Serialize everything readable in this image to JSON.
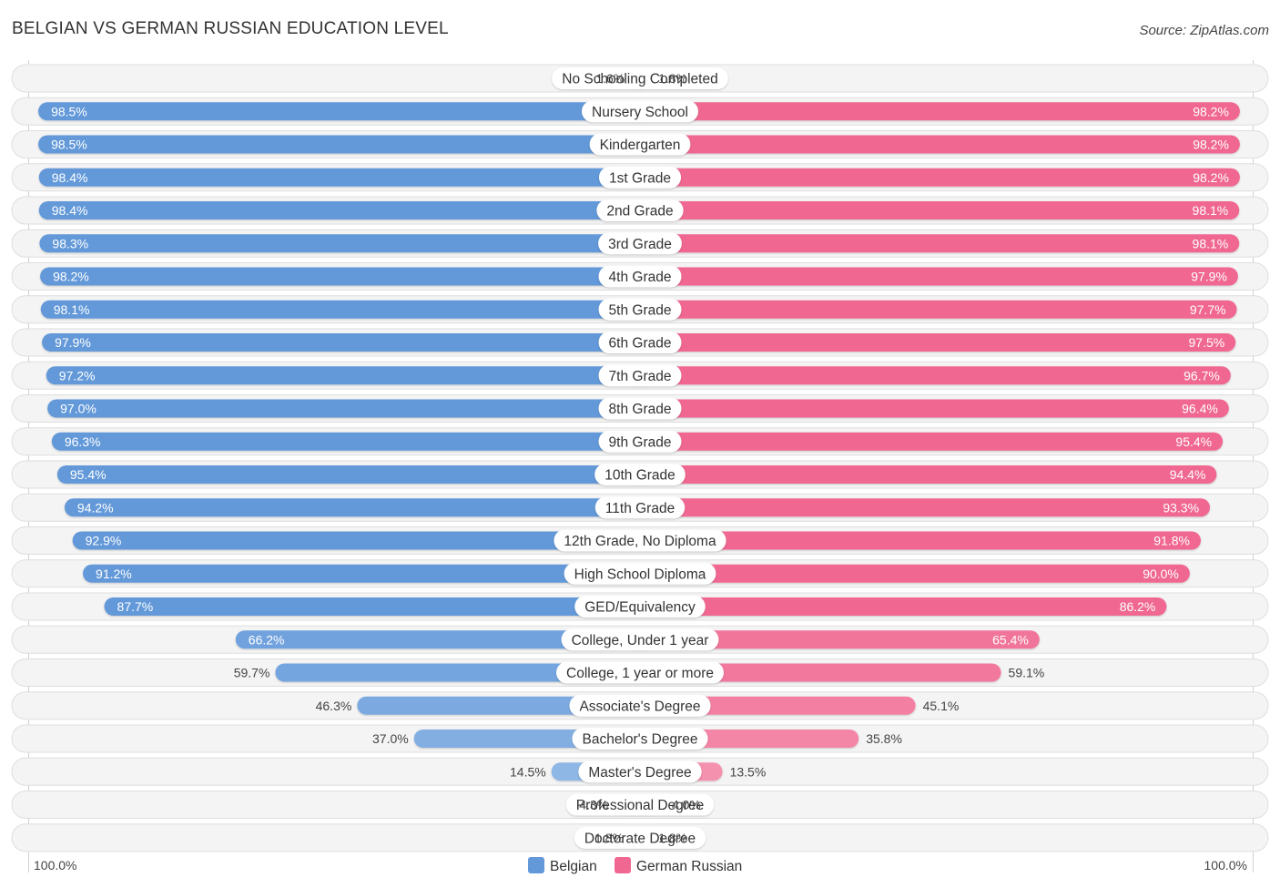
{
  "header": {
    "title": "BELGIAN VS GERMAN RUSSIAN EDUCATION LEVEL",
    "source": "Source: ZipAtlas.com"
  },
  "colors": {
    "belgian": "#6399d9",
    "belgian_light": "#a9c8ec",
    "german_russian": "#f06892",
    "german_russian_light": "#f7a8c0",
    "row_background": "#f4f4f4"
  },
  "chart_data": {
    "type": "bar",
    "orientation": "horizontal-diverging",
    "title": "BELGIAN VS GERMAN RUSSIAN EDUCATION LEVEL",
    "xlabel": "",
    "ylabel": "",
    "xlim": [
      0,
      100
    ],
    "axis_left_label": "100.0%",
    "axis_right_label": "100.0%",
    "legend_position": "bottom-center",
    "grid": false,
    "categories": [
      "No Schooling Completed",
      "Nursery School",
      "Kindergarten",
      "1st Grade",
      "2nd Grade",
      "3rd Grade",
      "4th Grade",
      "5th Grade",
      "6th Grade",
      "7th Grade",
      "8th Grade",
      "9th Grade",
      "10th Grade",
      "11th Grade",
      "12th Grade, No Diploma",
      "High School Diploma",
      "GED/Equivalency",
      "College, Under 1 year",
      "College, 1 year or more",
      "Associate's Degree",
      "Bachelor's Degree",
      "Master's Degree",
      "Professional Degree",
      "Doctorate Degree"
    ],
    "series": [
      {
        "name": "Belgian",
        "side": "left",
        "values": [
          1.6,
          98.5,
          98.5,
          98.4,
          98.4,
          98.3,
          98.2,
          98.1,
          97.9,
          97.2,
          97.0,
          96.3,
          95.4,
          94.2,
          92.9,
          91.2,
          87.7,
          66.2,
          59.7,
          46.3,
          37.0,
          14.5,
          4.3,
          1.8
        ],
        "labels": [
          "1.6%",
          "98.5%",
          "98.5%",
          "98.4%",
          "98.4%",
          "98.3%",
          "98.2%",
          "98.1%",
          "97.9%",
          "97.2%",
          "97.0%",
          "96.3%",
          "95.4%",
          "94.2%",
          "92.9%",
          "91.2%",
          "87.7%",
          "66.2%",
          "59.7%",
          "46.3%",
          "37.0%",
          "14.5%",
          "4.3%",
          "1.8%"
        ]
      },
      {
        "name": "German Russian",
        "side": "right",
        "values": [
          1.8,
          98.2,
          98.2,
          98.2,
          98.1,
          98.1,
          97.9,
          97.7,
          97.5,
          96.7,
          96.4,
          95.4,
          94.4,
          93.3,
          91.8,
          90.0,
          86.2,
          65.4,
          59.1,
          45.1,
          35.8,
          13.5,
          4.0,
          1.8
        ],
        "labels": [
          "1.8%",
          "98.2%",
          "98.2%",
          "98.2%",
          "98.1%",
          "98.1%",
          "97.9%",
          "97.7%",
          "97.5%",
          "96.7%",
          "96.4%",
          "95.4%",
          "94.4%",
          "93.3%",
          "91.8%",
          "90.0%",
          "86.2%",
          "65.4%",
          "59.1%",
          "45.1%",
          "35.8%",
          "13.5%",
          "4.0%",
          "1.8%"
        ]
      }
    ]
  },
  "legend": {
    "items": [
      {
        "label": "Belgian"
      },
      {
        "label": "German Russian"
      }
    ]
  }
}
